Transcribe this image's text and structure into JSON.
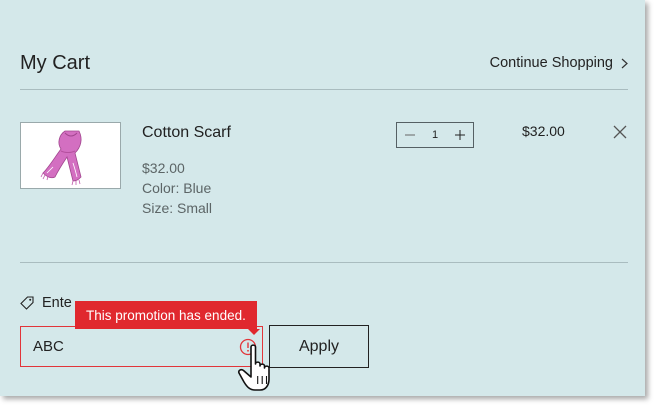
{
  "cart": {
    "title": "My Cart",
    "continue_label": "Continue Shopping"
  },
  "item": {
    "image_icon": "scarf-product-image",
    "name": "Cotton Scarf",
    "unit_price": "$32.00",
    "color": "Color: Blue",
    "size": "Size: Small",
    "quantity": "1",
    "total": "$32.00"
  },
  "promo": {
    "label_visible": "Ente",
    "input_value": "ABC",
    "error_message": "This promotion has ended.",
    "apply_label": "Apply"
  },
  "colors": {
    "background": "#d4e8ea",
    "error_red": "#e0282e",
    "text": "#1f1f1f",
    "muted_text": "#5c6566"
  }
}
